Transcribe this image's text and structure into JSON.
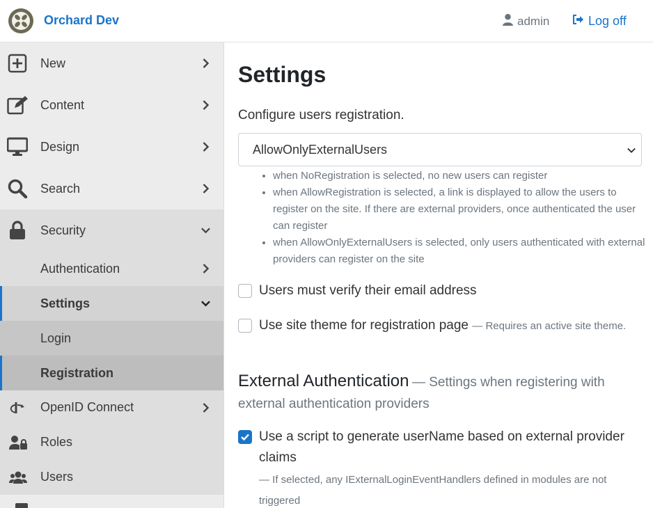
{
  "header": {
    "brand": "Orchard Dev",
    "user": "admin",
    "logoff": "Log off"
  },
  "sidebar": {
    "items": [
      {
        "label": "New",
        "icon": "plus-square-icon"
      },
      {
        "label": "Content",
        "icon": "edit-icon"
      },
      {
        "label": "Design",
        "icon": "desktop-icon"
      },
      {
        "label": "Search",
        "icon": "search-icon"
      },
      {
        "label": "Security",
        "icon": "lock-icon"
      }
    ],
    "security_sub": [
      {
        "label": "Authentication"
      },
      {
        "label": "Settings"
      },
      {
        "label": "Login"
      },
      {
        "label": "Registration"
      }
    ],
    "more": [
      {
        "label": "OpenID Connect",
        "icon": "openid-icon"
      },
      {
        "label": "Roles",
        "icon": "user-lock-icon"
      },
      {
        "label": "Users",
        "icon": "users-icon"
      }
    ]
  },
  "main": {
    "title": "Settings",
    "registration_label": "Configure users registration.",
    "registration_value": "AllowOnlyExternalUsers",
    "hints": [
      "when NoRegistration is selected, no new users can register",
      "when AllowRegistration is selected, a link is displayed to allow the users to register on the site. If there are external providers, once authenticated the user can register",
      "when AllowOnlyExternalUsers is selected, only users authenticated with external providers can register on the site"
    ],
    "verify_email": {
      "label": "Users must verify their email address",
      "checked": false
    },
    "site_theme": {
      "label": "Use site theme for registration page",
      "hint": "— Requires an active site theme.",
      "checked": false
    },
    "external_title": "External Authentication",
    "external_sub": "— Settings when registering with external authentication providers",
    "use_script": {
      "label": "Use a script to generate userName based on external provider claims",
      "hint": "— If selected, any IExternalLoginEventHandlers defined in modules are not triggered",
      "checked": true
    }
  },
  "colors": {
    "accent": "#1a74c9",
    "sidebar_bg": "#ececec"
  }
}
